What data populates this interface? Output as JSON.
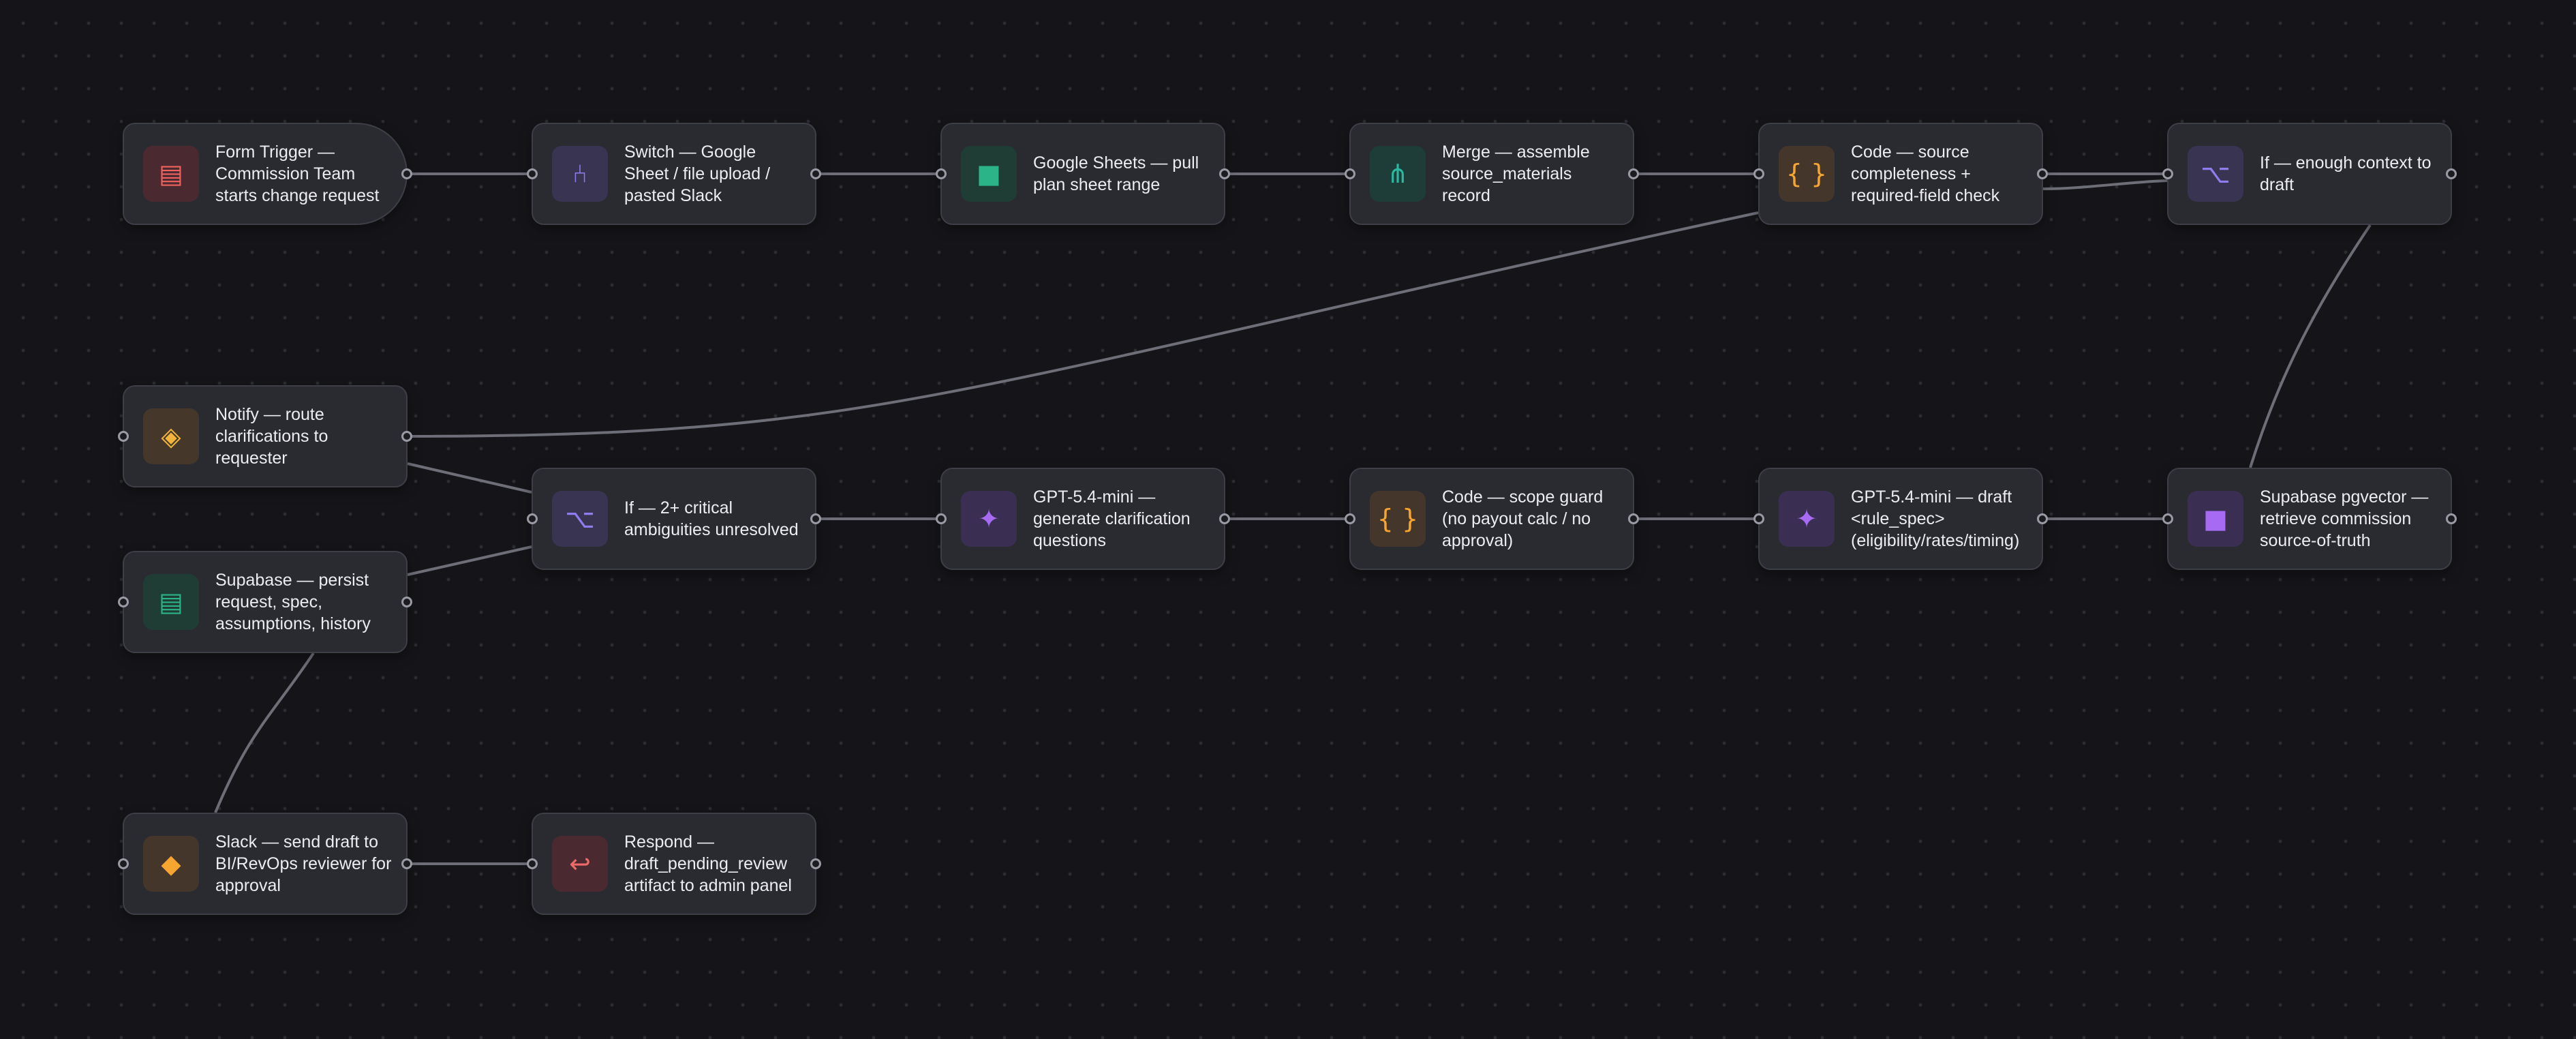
{
  "workflow": {
    "nodes": [
      {
        "id": "form_trigger",
        "label": "Form Trigger — Commission Team starts change request",
        "icon": "form-icon",
        "glyph": "▤",
        "color": "#f0625e",
        "kind": "trigger"
      },
      {
        "id": "switch",
        "label": "Switch — Google Sheet / file upload / pasted Slack",
        "icon": "switch-icon",
        "glyph": "⑃",
        "color": "#8f7df0"
      },
      {
        "id": "google_sheets",
        "label": "Google Sheets — pull plan sheet range",
        "icon": "sheets-icon",
        "glyph": "■",
        "color": "#2bb488"
      },
      {
        "id": "merge",
        "label": "Merge — assemble source_materials record",
        "icon": "merge-icon",
        "glyph": "⋔",
        "color": "#2bb8a0"
      },
      {
        "id": "code_completeness",
        "label": "Code — source completeness + required-field check",
        "icon": "code-icon",
        "glyph": "{ }",
        "color": "#f7a531"
      },
      {
        "id": "if_context",
        "label": "If — enough context to draft",
        "icon": "branch-icon",
        "glyph": "⌥",
        "color": "#8f7df0"
      },
      {
        "id": "notify",
        "label": "Notify — route clarifications to requester",
        "icon": "notify-icon",
        "glyph": "◈",
        "color": "#f2b43c"
      },
      {
        "id": "if_ambiguities",
        "label": "If — 2+ critical ambiguities unresolved",
        "icon": "branch-icon",
        "glyph": "⌥",
        "color": "#8f7df0"
      },
      {
        "id": "gpt_questions",
        "label": "GPT-5.4-mini — generate clarification questions",
        "icon": "sparkle-icon",
        "glyph": "✦",
        "color": "#a66bf2"
      },
      {
        "id": "code_scope",
        "label": "Code — scope guard (no payout calc / no approval)",
        "icon": "code-icon",
        "glyph": "{ }",
        "color": "#f7a531"
      },
      {
        "id": "gpt_draft",
        "label": "GPT-5.4-mini — draft <rule_spec> (eligibility/rates/timing)",
        "icon": "sparkle-icon",
        "glyph": "✦",
        "color": "#a66bf2"
      },
      {
        "id": "supabase_pgvector",
        "label": "Supabase pgvector — retrieve commission source-of-truth",
        "icon": "database-icon",
        "glyph": "■",
        "color": "#a66bf2"
      },
      {
        "id": "supabase_persist",
        "label": "Supabase — persist request, spec, assumptions, history",
        "icon": "database-icon",
        "glyph": "▤",
        "color": "#2bb488"
      },
      {
        "id": "slack",
        "label": "Slack — send draft to BI/RevOps reviewer for approval",
        "icon": "slack-icon",
        "glyph": "◆",
        "color": "#f7a531"
      },
      {
        "id": "respond",
        "label": "Respond — draft_pending_review artifact to admin panel",
        "icon": "return-icon",
        "glyph": "↩",
        "color": "#ee6a68"
      }
    ],
    "edges": [
      {
        "from": "form_trigger",
        "to": "switch"
      },
      {
        "from": "switch",
        "to": "google_sheets"
      },
      {
        "from": "google_sheets",
        "to": "merge"
      },
      {
        "from": "merge",
        "to": "code_completeness"
      },
      {
        "from": "code_completeness",
        "to": "if_context"
      },
      {
        "from": "if_context",
        "to": "code_completeness",
        "note": "return"
      },
      {
        "from": "code_completeness",
        "to": "notify"
      },
      {
        "from": "if_context",
        "to": "supabase_pgvector"
      },
      {
        "from": "notify",
        "to": "if_ambiguities"
      },
      {
        "from": "supabase_persist",
        "to": "if_ambiguities"
      },
      {
        "from": "if_ambiguities",
        "to": "gpt_questions"
      },
      {
        "from": "gpt_questions",
        "to": "code_scope"
      },
      {
        "from": "code_scope",
        "to": "gpt_draft"
      },
      {
        "from": "gpt_draft",
        "to": "supabase_pgvector"
      },
      {
        "from": "supabase_persist",
        "to": "slack"
      },
      {
        "from": "slack",
        "to": "respond"
      }
    ]
  }
}
